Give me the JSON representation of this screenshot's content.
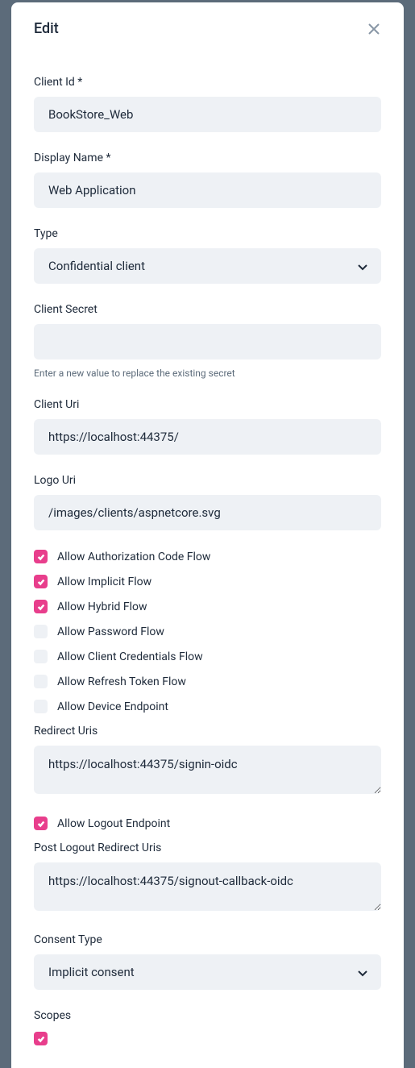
{
  "modal": {
    "title": "Edit",
    "clientId": {
      "label": "Client Id *",
      "value": "BookStore_Web"
    },
    "displayName": {
      "label": "Display Name *",
      "value": "Web Application"
    },
    "type": {
      "label": "Type",
      "value": "Confidential client"
    },
    "clientSecret": {
      "label": "Client Secret",
      "value": "",
      "helper": "Enter a new value to replace the existing secret"
    },
    "clientUri": {
      "label": "Client Uri",
      "value": "https://localhost:44375/"
    },
    "logoUri": {
      "label": "Logo Uri",
      "value": "/images/clients/aspnetcore.svg"
    },
    "flows": {
      "authCode": "Allow Authorization Code Flow",
      "implicit": "Allow Implicit Flow",
      "hybrid": "Allow Hybrid Flow",
      "password": "Allow Password Flow",
      "clientCreds": "Allow Client Credentials Flow",
      "refresh": "Allow Refresh Token Flow",
      "device": "Allow Device Endpoint"
    },
    "redirectUris": {
      "label": "Redirect Uris",
      "value": "https://localhost:44375/signin-oidc"
    },
    "logout": {
      "label": "Allow Logout Endpoint"
    },
    "postLogout": {
      "label": "Post Logout Redirect Uris",
      "value": "https://localhost:44375/signout-callback-oidc"
    },
    "consentType": {
      "label": "Consent Type",
      "value": "Implicit consent"
    },
    "scopes": {
      "label": "Scopes"
    }
  }
}
